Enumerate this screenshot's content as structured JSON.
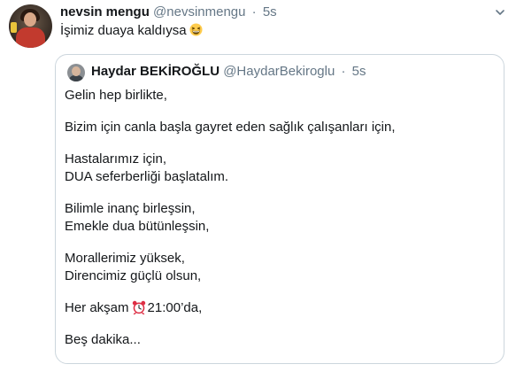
{
  "tweet": {
    "author_name": "nevsin mengu",
    "author_handle": "@nevsinmengu",
    "separator": "·",
    "time": "5s",
    "text": "İşimiz duaya kaldıysa",
    "emoji": "grinning-squinting-face-icon"
  },
  "quoted_tweet": {
    "author_name": "Haydar BEKİROĞLU",
    "author_handle": "@HaydarBekiroglu",
    "separator": "·",
    "time": "5s",
    "lines": {
      "l1": "Gelin hep birlikte,",
      "l2": "Bizim için canla başla gayret eden sağlık çalışanları için,",
      "l3": "Hastalarımız için,",
      "l4": "DUA seferberliği başlatalım.",
      "l5": "Bilimle inanç birleşsin,",
      "l6": "Emekle dua bütünleşsin,",
      "l7": "Morallerimiz yüksek,",
      "l8": "Direncimiz güçlü olsun,",
      "l9_before": "Her akşam",
      "l9_after": "21:00’da,",
      "l10": "Beş dakika..."
    },
    "emoji": "alarm-clock-icon"
  },
  "colors": {
    "text": "#14171a",
    "secondary": "#657786",
    "border": "#ccd6dd"
  }
}
